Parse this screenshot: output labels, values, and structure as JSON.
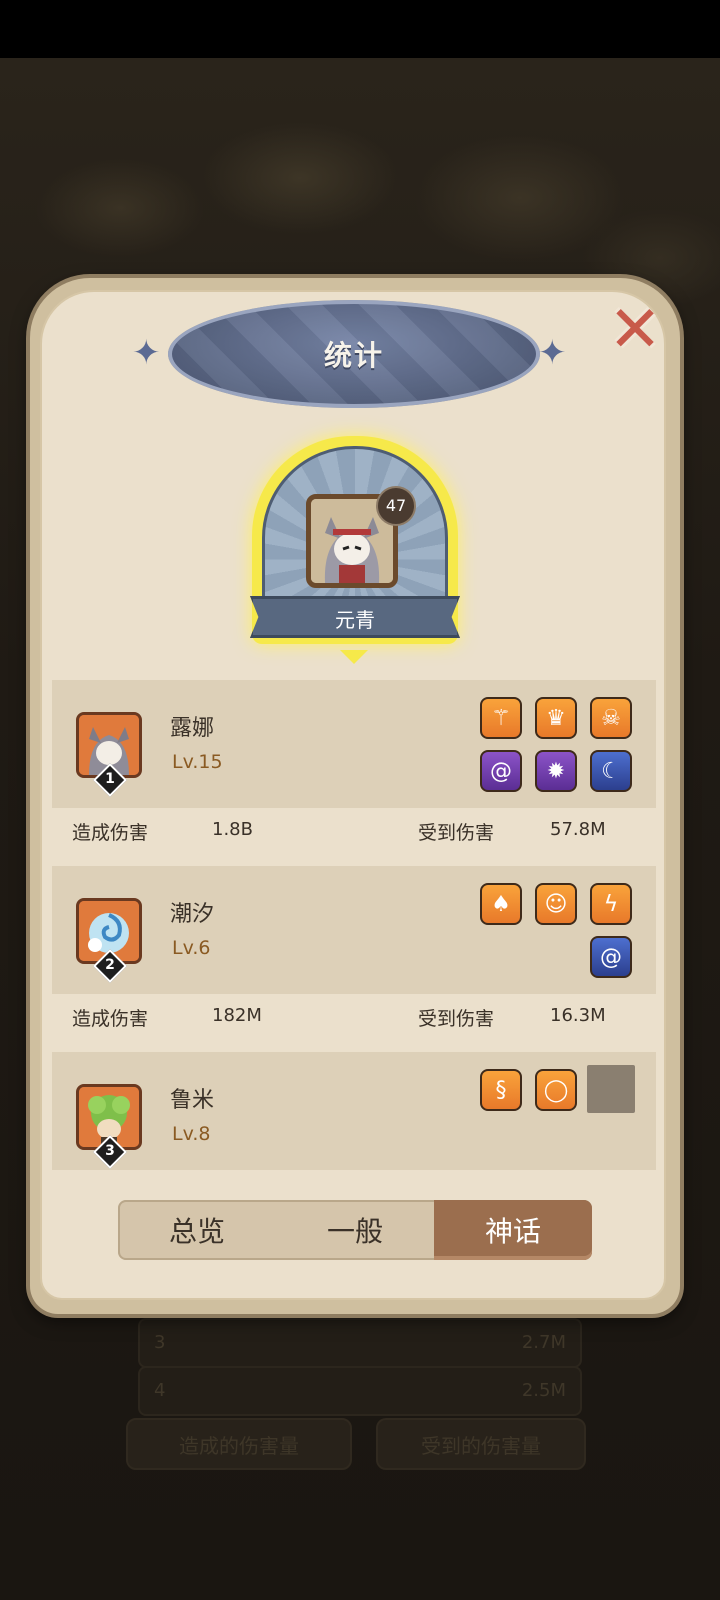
{
  "window": {
    "title": "统计"
  },
  "background": {
    "rows": [
      {
        "rank": "3",
        "value": "2.7M"
      },
      {
        "rank": "4",
        "value": "2.5M"
      }
    ],
    "tabs": [
      "造成的伤害量",
      "受到的伤害量"
    ]
  },
  "mvp": {
    "name": "元青",
    "level": "47"
  },
  "heroes": [
    {
      "rank": "1",
      "name": "露娜",
      "level": "Lv.15",
      "dealt_label": "造成伤害",
      "dealt": "1.8B",
      "taken_label": "受到伤害",
      "taken": "57.8M",
      "items": [
        {
          "icon": "staff-icon",
          "color": "orange"
        },
        {
          "icon": "crown-icon",
          "color": "orange"
        },
        {
          "icon": "skull-wand-icon",
          "color": "orange"
        },
        {
          "icon": "vortex-icon",
          "color": "purple"
        },
        {
          "icon": "flame-burst-icon",
          "color": "purple"
        },
        {
          "icon": "moon-orb-icon",
          "color": "blue"
        }
      ]
    },
    {
      "rank": "2",
      "name": "潮汐",
      "level": "Lv.6",
      "dealt_label": "造成伤害",
      "dealt": "182M",
      "taken_label": "受到伤害",
      "taken": "16.3M",
      "items": [
        {
          "icon": "witch-hat-icon",
          "color": "orange"
        },
        {
          "icon": "ghost-icon",
          "color": "orange"
        },
        {
          "icon": "lightning-orb-icon",
          "color": "orange"
        },
        {
          "icon": "vortex-icon",
          "color": "blue"
        }
      ]
    },
    {
      "rank": "3",
      "name": "鲁米",
      "level": "Lv.8",
      "items": [
        {
          "icon": "whip-icon",
          "color": "orange"
        },
        {
          "icon": "ring-icon",
          "color": "orange"
        },
        {
          "icon": "empty-slot",
          "color": "empty"
        }
      ]
    }
  ],
  "tabs": [
    {
      "label": "总览",
      "active": false
    },
    {
      "label": "一般",
      "active": false
    },
    {
      "label": "神话",
      "active": true
    }
  ],
  "colors": {
    "accent": "#9b6e4e",
    "mvp_glow": "#f6e94a",
    "close": "#c85a4a"
  }
}
